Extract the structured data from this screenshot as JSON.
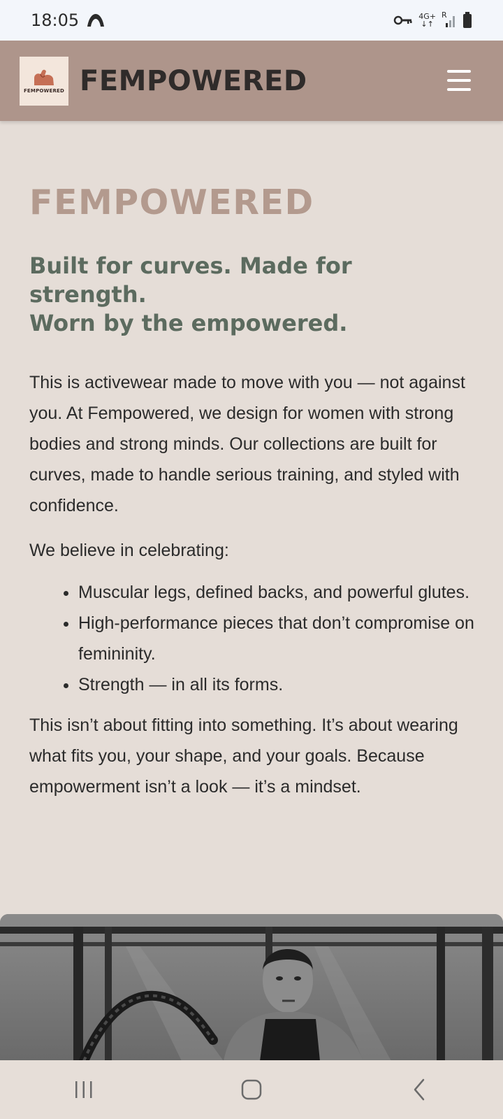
{
  "status_bar": {
    "time": "18:05",
    "network": "4G+",
    "roaming": "R",
    "icons": [
      "app-notification-icon",
      "key-icon",
      "signal-icon",
      "battery-icon"
    ]
  },
  "header": {
    "logo_text": "FEMPOWERED",
    "brand": "FEMPOWERED",
    "menu_icon": "hamburger-menu-icon",
    "background": "#ae958b"
  },
  "main": {
    "title": "FEMPOWERED",
    "tagline_lines": [
      "Built for curves. Made for",
      "strength.",
      "Worn by the empowered."
    ],
    "intro": "This is activewear made to move with you — not against you. At Fempowered, we design for women with strong bodies and strong minds. Our collections are built for curves, made to handle serious training, and styled with confidence.",
    "believe_heading": "We believe in celebrating:",
    "beliefs": [
      "Muscular legs, defined backs, and powerful glutes.",
      "High-performance pieces that don’t compromise on femininity.",
      "Strength — in all its forms."
    ],
    "closing": "This isn’t about fitting into something. It’s about wearing what fits you, your shape, and your goals. Because empowerment isn’t a look — it’s a mindset."
  },
  "hero_image": {
    "description_icon": "woman-battle-rope-photo"
  },
  "nav_bar": {
    "icons": [
      "recent-apps-icon",
      "home-icon",
      "back-icon"
    ]
  },
  "colors": {
    "page_bg": "#e5ddd7",
    "title": "#b39a8e",
    "tagline": "#5c6b5f"
  }
}
